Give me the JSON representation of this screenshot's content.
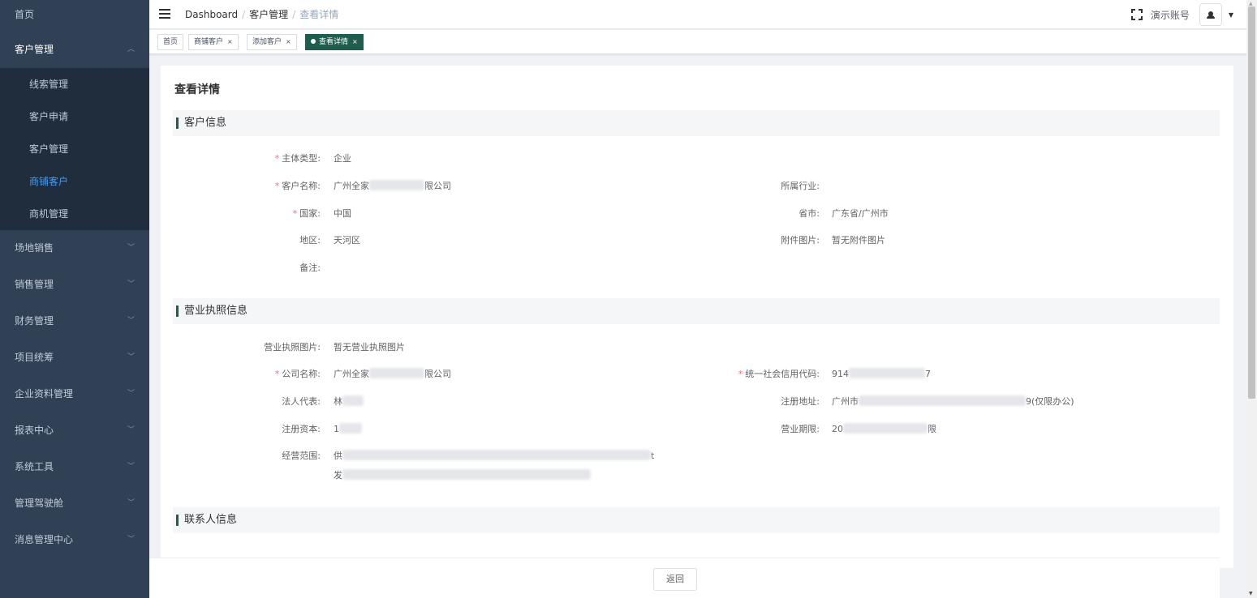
{
  "sidebar": {
    "items": [
      {
        "label": "首页"
      },
      {
        "label": "客户管理",
        "open": true
      },
      {
        "label": "场地销售"
      },
      {
        "label": "销售管理"
      },
      {
        "label": "财务管理"
      },
      {
        "label": "项目统筹"
      },
      {
        "label": "企业资料管理"
      },
      {
        "label": "报表中心"
      },
      {
        "label": "系统工具"
      },
      {
        "label": "管理驾驶舱"
      },
      {
        "label": "消息管理中心"
      }
    ],
    "submenu": [
      {
        "label": "线索管理"
      },
      {
        "label": "客户申请"
      },
      {
        "label": "客户管理"
      },
      {
        "label": "商铺客户",
        "active": true
      },
      {
        "label": "商机管理"
      }
    ]
  },
  "header": {
    "breadcrumb": [
      "Dashboard",
      "客户管理",
      "查看详情"
    ],
    "account_name": "演示账号"
  },
  "tags": [
    {
      "label": "首页"
    },
    {
      "label": "商铺客户"
    },
    {
      "label": "添加客户"
    },
    {
      "label": "查看详情",
      "active": true
    }
  ],
  "page": {
    "title": "查看详情",
    "sections": {
      "customer_info": "客户信息",
      "license_info": "营业执照信息",
      "contact_info": "联系人信息"
    },
    "customer": {
      "entity_type_label": "主体类型:",
      "entity_type": "企业",
      "name_label": "客户名称:",
      "name_prefix": "广州全家",
      "name_suffix": "限公司",
      "industry_label": "所属行业:",
      "country_label": "国家:",
      "country": "中国",
      "province_label": "省市:",
      "province": "广东省/广州市",
      "district_label": "地区:",
      "district": "天河区",
      "attach_label": "附件图片:",
      "attach": "暂无附件图片",
      "remark_label": "备注:"
    },
    "license": {
      "image_label": "营业执照图片:",
      "image": "暂无营业执照图片",
      "company_label": "公司名称:",
      "company_prefix": "广州全家",
      "company_suffix": "限公司",
      "credit_label": "统一社会信用代码:",
      "credit_prefix": "914",
      "credit_suffix": "7",
      "legal_label": "法人代表:",
      "legal_prefix": "林",
      "address_label": "注册地址:",
      "address_prefix": "广州市",
      "address_suffix": "9(仅限办公)",
      "capital_label": "注册资本:",
      "capital_prefix": "1",
      "term_label": "营业期限:",
      "term_prefix": "20",
      "term_suffix": "限",
      "scope_label": "经营范围:",
      "scope_line1_prefix": "供",
      "scope_line1_suffix": "t",
      "scope_line2_prefix": "发"
    }
  },
  "footer": {
    "back_label": "返回"
  }
}
